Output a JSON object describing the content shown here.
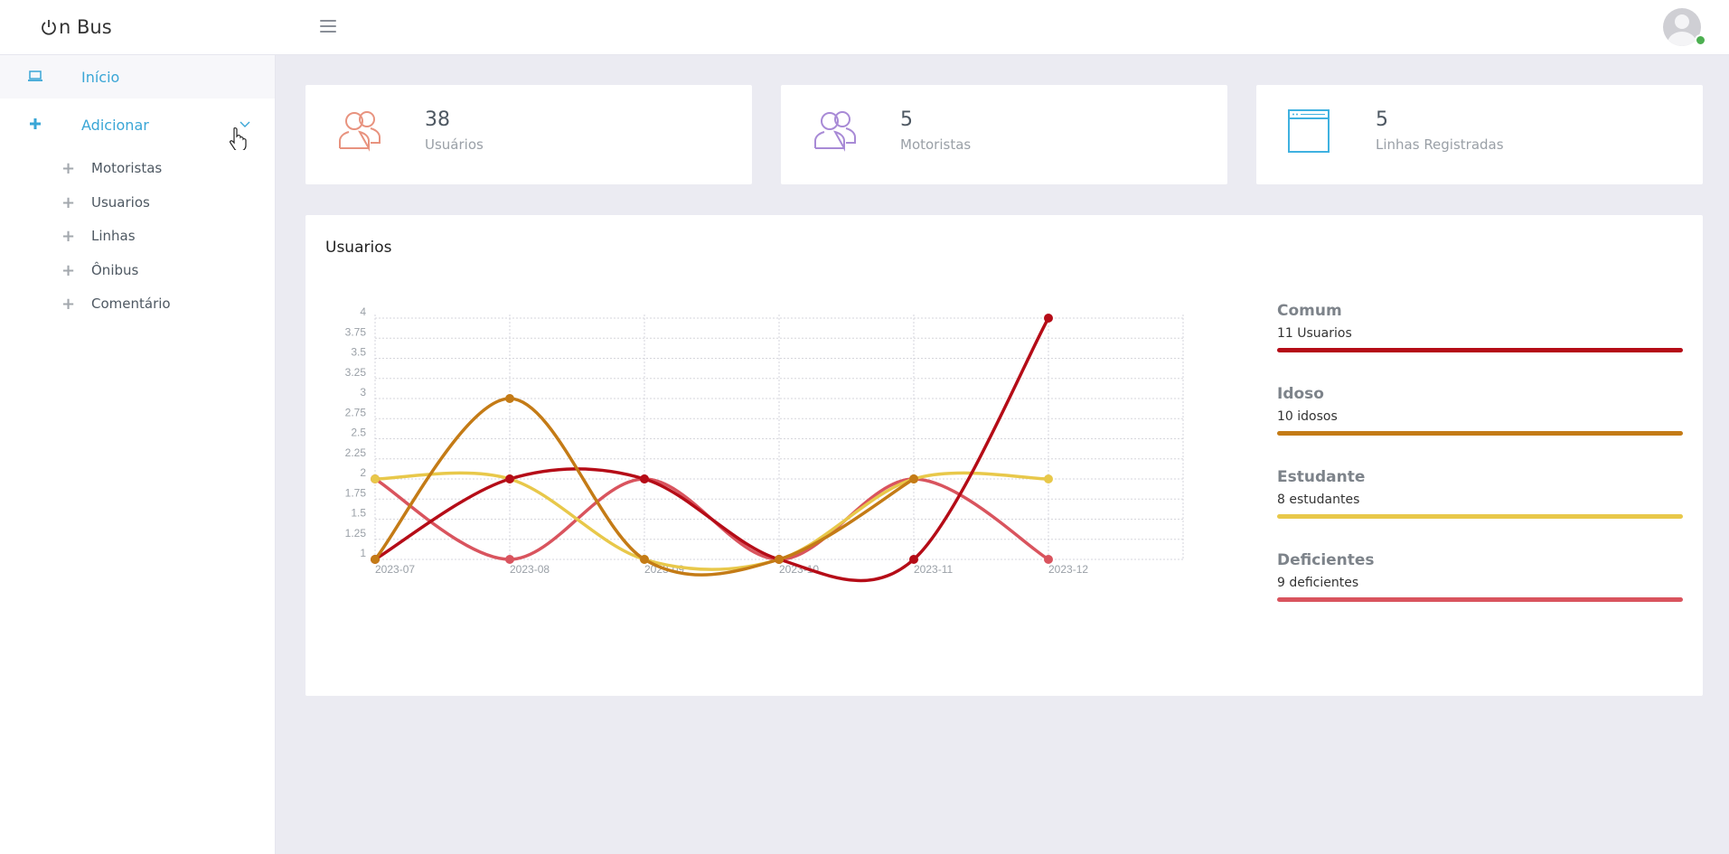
{
  "brand": {
    "name": "n Bus"
  },
  "sidebar": {
    "items": [
      {
        "label": "Início",
        "icon": "laptop-icon"
      },
      {
        "label": "Adicionar",
        "icon": "plus-icon"
      }
    ],
    "subitems": [
      {
        "label": "Motoristas"
      },
      {
        "label": "Usuarios"
      },
      {
        "label": "Linhas"
      },
      {
        "label": "Ônibus"
      },
      {
        "label": "Comentário"
      }
    ]
  },
  "stats": [
    {
      "value": "38",
      "label": "Usuários",
      "icon": "users-icon",
      "color": "#e8937f"
    },
    {
      "value": "5",
      "label": "Motoristas",
      "icon": "users-icon",
      "color": "#a88ad6"
    },
    {
      "value": "5",
      "label": "Linhas Registradas",
      "icon": "browser-window-icon",
      "color": "#3fb1e0"
    }
  ],
  "panel": {
    "title": "Usuarios"
  },
  "legend": [
    {
      "name": "Comum",
      "count": "11 Usuarios",
      "color": "#b50c17"
    },
    {
      "name": "Idoso",
      "count": "10 idosos",
      "color": "#c47b16"
    },
    {
      "name": "Estudante",
      "count": "8 estudantes",
      "color": "#e8c84a"
    },
    {
      "name": "Deficientes",
      "count": "9 deficientes",
      "color": "#d9545e"
    }
  ],
  "chart_data": {
    "type": "line",
    "x": [
      "2023-07",
      "2023-08",
      "2023-09",
      "2023-10",
      "2023-11",
      "2023-12"
    ],
    "y_ticks": [
      "1",
      "1.25",
      "1.5",
      "1.75",
      "2",
      "2.25",
      "2.5",
      "2.75",
      "3",
      "3.25",
      "3.5",
      "3.75",
      "4"
    ],
    "ylim": [
      1,
      4
    ],
    "grid": true,
    "series": [
      {
        "name": "Comum",
        "color": "#b50c17",
        "values": [
          1,
          2,
          2,
          1,
          1,
          4
        ]
      },
      {
        "name": "Idoso",
        "color": "#c47b16",
        "values": [
          1,
          3,
          1,
          1,
          2,
          null
        ]
      },
      {
        "name": "Estudante",
        "color": "#e8c84a",
        "values": [
          2,
          2,
          1,
          1,
          2,
          2
        ]
      },
      {
        "name": "Deficientes",
        "color": "#d9545e",
        "values": [
          2,
          1,
          2,
          1,
          2,
          1
        ]
      }
    ]
  }
}
